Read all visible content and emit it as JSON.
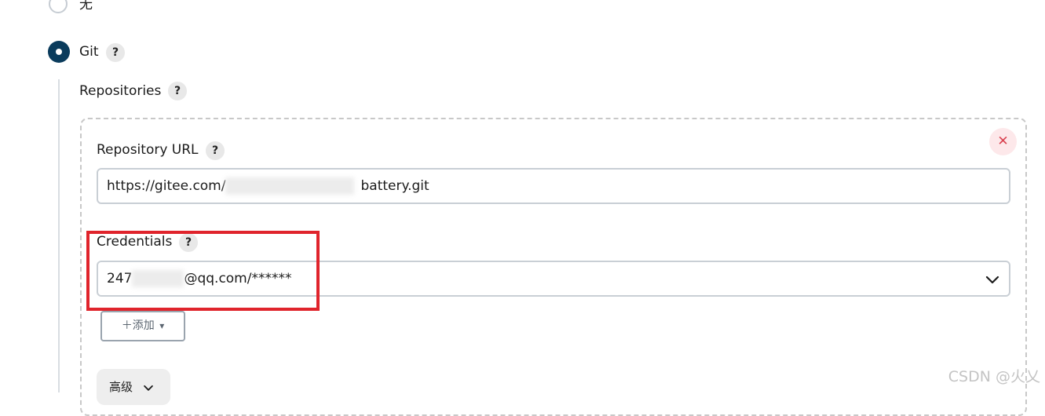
{
  "scm_options": {
    "none_label": "无",
    "git_label": "Git",
    "git_selected": true,
    "none_selected": false
  },
  "help_glyph": "?",
  "repositories": {
    "title": "Repositories",
    "url_label": "Repository URL",
    "url_value_prefix": "https://gitee.com/",
    "url_value_suffix": "battery.git",
    "delete_glyph": "✕",
    "credentials_label": "Credentials",
    "credentials_value_prefix": "247",
    "credentials_value_suffix": "@qq.com/******",
    "add_button_label": "＋添加",
    "add_caret": "▾",
    "advanced_button_label": "高级"
  },
  "watermark": "CSDN @火乂",
  "colors": {
    "radio_selected": "#0a3b5c",
    "highlight_box": "#e0242c",
    "delete_icon": "#d9404e"
  },
  "icons": {
    "delete": "close-icon",
    "select_arrow": "chevron-down-icon",
    "help": "help-icon"
  }
}
